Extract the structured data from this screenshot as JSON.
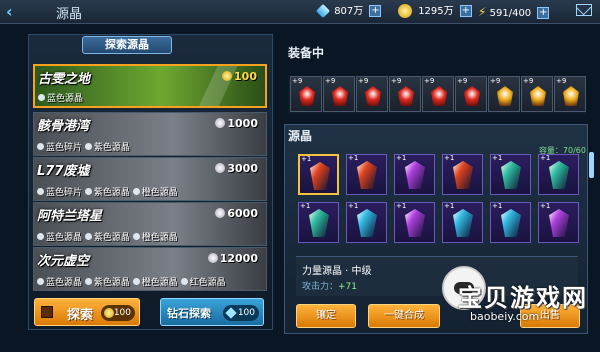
{
  "header": {
    "title": "源晶",
    "diamonds": "807万",
    "gold": "1295万",
    "energy": "591/400",
    "plus": "+"
  },
  "explore": {
    "title": "探索源晶",
    "areas": [
      {
        "name": "古雯之地",
        "cost": "100",
        "drops": [
          "蓝色源晶"
        ]
      },
      {
        "name": "骸骨港湾",
        "cost": "1000",
        "drops": [
          "蓝色碎片",
          "紫色源晶"
        ]
      },
      {
        "name": "L77废墟",
        "cost": "3000",
        "drops": [
          "蓝色碎片",
          "紫色源晶",
          "橙色源晶"
        ]
      },
      {
        "name": "阿特兰塔星",
        "cost": "6000",
        "drops": [
          "蓝色源晶",
          "紫色源晶",
          "橙色源晶"
        ]
      },
      {
        "name": "次元虚空",
        "cost": "12000",
        "drops": [
          "蓝色源晶",
          "紫色源晶",
          "橙色源晶",
          "红色源晶"
        ]
      }
    ],
    "explore_btn": {
      "label": "探索",
      "cost": "100"
    },
    "diamond_btn": {
      "label": "钻石探索",
      "cost": "100"
    }
  },
  "equipped": {
    "title": "装备中",
    "slots": [
      {
        "level": "+9",
        "color": "#e0281e"
      },
      {
        "level": "+9",
        "color": "#e0281e"
      },
      {
        "level": "+9",
        "color": "#e0281e"
      },
      {
        "level": "+9",
        "color": "#e0281e"
      },
      {
        "level": "+9",
        "color": "#e0281e"
      },
      {
        "level": "+9",
        "color": "#e0281e"
      },
      {
        "level": "+9",
        "color": "#f0b020"
      },
      {
        "level": "+9",
        "color": "#f0b020"
      },
      {
        "level": "+9",
        "color": "#f0b020"
      }
    ]
  },
  "crystals": {
    "title": "源晶",
    "capacity": "容量：70/60",
    "items": [
      {
        "level": "+1",
        "color": "#e0441e",
        "selected": true
      },
      {
        "level": "+1",
        "color": "#e0441e"
      },
      {
        "level": "+1",
        "color": "#b040e0"
      },
      {
        "level": "+1",
        "color": "#e0441e"
      },
      {
        "level": "+1",
        "color": "#30c0a0"
      },
      {
        "level": "+1",
        "color": "#30c0a0"
      },
      {
        "level": "+1",
        "color": "#30c0a0"
      },
      {
        "level": "+1",
        "color": "#30b8e0"
      },
      {
        "level": "+1",
        "color": "#b040e0"
      },
      {
        "level": "+1",
        "color": "#30b8e0"
      },
      {
        "level": "+1",
        "color": "#30b8e0"
      },
      {
        "level": "+1",
        "color": "#b040e0"
      }
    ]
  },
  "info": {
    "name": "力量源晶 · 中级",
    "stat_key": "攻击力：",
    "stat_val": "+71"
  },
  "actions": {
    "equip": "镶定",
    "merge": "一键合成",
    "sell": "出售"
  },
  "watermark": {
    "text": "宝贝游戏网",
    "url": "baobeiy.com"
  }
}
